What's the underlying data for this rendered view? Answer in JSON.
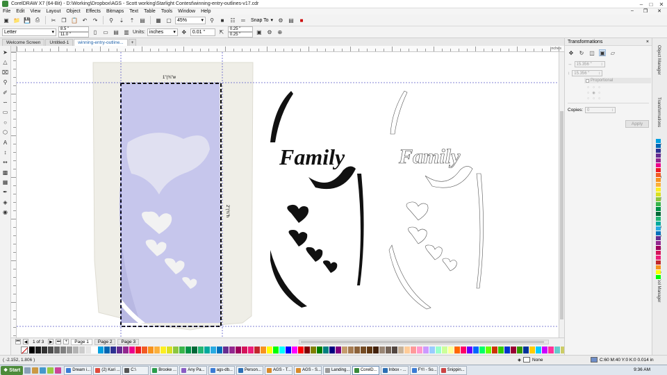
{
  "window": {
    "title": "CorelDRAW X7 (64-Bit) - D:\\Working\\Dropbox\\AGS - Scott working\\Starlight Contest\\winning-entry-outlines-v17.cdr"
  },
  "menu": [
    "File",
    "Edit",
    "View",
    "Layout",
    "Object",
    "Effects",
    "Bitmaps",
    "Text",
    "Table",
    "Tools",
    "Window",
    "Help"
  ],
  "toolbar": {
    "zoom": "45%",
    "snap_to": "Snap To"
  },
  "property_bar": {
    "page_size": "Letter",
    "width": "8.5 \"",
    "height": "11.0 \"",
    "units_label": "Units:",
    "units": "inches",
    "nudge": "0.01 \"",
    "dup_x": "0.25 \"",
    "dup_y": "0.25 \""
  },
  "tabs": [
    {
      "label": "Welcome Screen",
      "active": false
    },
    {
      "label": "Untitled-1",
      "active": false
    },
    {
      "label": "winning-entry-outline...",
      "active": true
    },
    {
      "label": "+",
      "active": false
    }
  ],
  "ruler": {
    "unit": "inches"
  },
  "canvas": {
    "dim_top": "1\"(¾\"w",
    "dim_side": "2\"(¾\"h",
    "family_word": "Family"
  },
  "pager": {
    "count": "1 of 3",
    "pages": [
      "Page 1",
      "Page 2",
      "Page 3"
    ]
  },
  "docker": {
    "title": "Transformations",
    "size_w": "15.356 \"",
    "size_h": "15.356 \"",
    "proportional": "Proportional",
    "copies_label": "Copies:",
    "copies": "0",
    "apply": "Apply"
  },
  "side_tabs": [
    "Object Manager",
    "Transformations",
    "Guidelines",
    "Tray",
    "Shaping",
    "Text Properties",
    "Symbol Manager"
  ],
  "status": {
    "coords": "( -2.152, 1.806 )",
    "fill": "None",
    "outline": "C:60 M:40 Y:0 K:0  0.014 in"
  },
  "taskbar": {
    "start": "Start",
    "items": [
      "Dream i...",
      "(2) Kari ...",
      "C:\\",
      "Brooke ...",
      "Any Pa...",
      "ags-db...",
      "Person...",
      "AGS - T...",
      "AGS - S...",
      "Landing...",
      "CorelD...",
      "Inbox - ...",
      "FYI - So...",
      "Snippin..."
    ],
    "active_index": 10,
    "time": "9:36 AM"
  },
  "colors": {
    "selection_dash": "#000000",
    "guide": "#5a5ac8",
    "stencil_fill": "#c6c6ec",
    "paper": "#efeee7"
  },
  "palette": [
    "#000000",
    "#1a1a1a",
    "#333333",
    "#4d4d4d",
    "#666666",
    "#808080",
    "#999999",
    "#b3b3b3",
    "#cccccc",
    "#e6e6e6",
    "#ffffff",
    "#00a0e0",
    "#0066b3",
    "#2e3192",
    "#662d91",
    "#92278f",
    "#ec008c",
    "#ed1c24",
    "#f15a24",
    "#f7931e",
    "#fbb03b",
    "#fcee21",
    "#d9e021",
    "#8cc63f",
    "#39b54a",
    "#009245",
    "#006837",
    "#22b573",
    "#00a99d",
    "#29abe2",
    "#0071bc",
    "#662d91",
    "#93278f",
    "#9e005d",
    "#d4145a",
    "#ed1e79",
    "#c1272d",
    "#f7931e",
    "#ffff00",
    "#00ff00",
    "#00ffff",
    "#0000ff",
    "#ff00ff",
    "#ff0000",
    "#800000",
    "#808000",
    "#008000",
    "#008080",
    "#000080",
    "#800080",
    "#c69c6d",
    "#a67c52",
    "#8c6239",
    "#754c24",
    "#603813",
    "#42210b",
    "#998675",
    "#736357",
    "#534741",
    "#c7b299",
    "#ffcc99",
    "#ff9999",
    "#ff99cc",
    "#cc99ff",
    "#99ccff",
    "#99ffcc",
    "#ccff99",
    "#ffff99",
    "#ff6600",
    "#ff0066",
    "#6600ff",
    "#0066ff",
    "#00ff66",
    "#66ff00",
    "#cc3300",
    "#33cc00",
    "#0033cc",
    "#990033",
    "#339900",
    "#003399",
    "#ffcc00",
    "#00ccff",
    "#cc00ff",
    "#ff3399",
    "#66cccc",
    "#cccc66",
    "#cc66cc",
    "#996633",
    "#336699",
    "#669933"
  ]
}
